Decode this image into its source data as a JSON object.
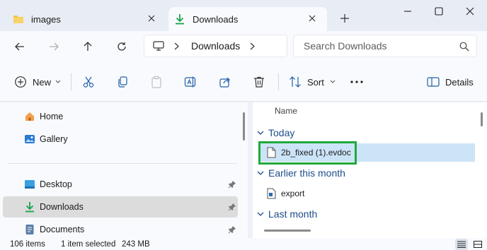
{
  "tabs": [
    {
      "label": "images",
      "icon": "folder-icon",
      "active": false
    },
    {
      "label": "Downloads",
      "icon": "download-icon",
      "active": true
    }
  ],
  "address": {
    "breadcrumb": "Downloads",
    "search_placeholder": "Search Downloads"
  },
  "toolbar": {
    "new_label": "New",
    "sort_label": "Sort",
    "details_label": "Details"
  },
  "sidebar": {
    "items": [
      {
        "label": "Home",
        "icon": "home-icon"
      },
      {
        "label": "Gallery",
        "icon": "gallery-icon"
      },
      {
        "label": "Desktop",
        "icon": "desktop-icon"
      },
      {
        "label": "Downloads",
        "icon": "download-icon"
      },
      {
        "label": "Documents",
        "icon": "documents-icon"
      }
    ]
  },
  "filelist": {
    "column_name": "Name",
    "groups": [
      {
        "label": "Today",
        "files": [
          {
            "name": "2b_fixed (1).evdoc",
            "selected": true
          }
        ]
      },
      {
        "label": "Earlier this month",
        "files": [
          {
            "name": "export",
            "selected": false
          }
        ]
      },
      {
        "label": "Last month",
        "files": []
      }
    ]
  },
  "status": {
    "item_count": "106 items",
    "selection": "1 item selected",
    "size": "243 MB"
  },
  "colors": {
    "accent": "#1d4e89",
    "selection": "#cce4f7",
    "highlight_box": "#1faa3b",
    "download_green": "#16a34a",
    "folder_yellow": "#f4c54a"
  }
}
